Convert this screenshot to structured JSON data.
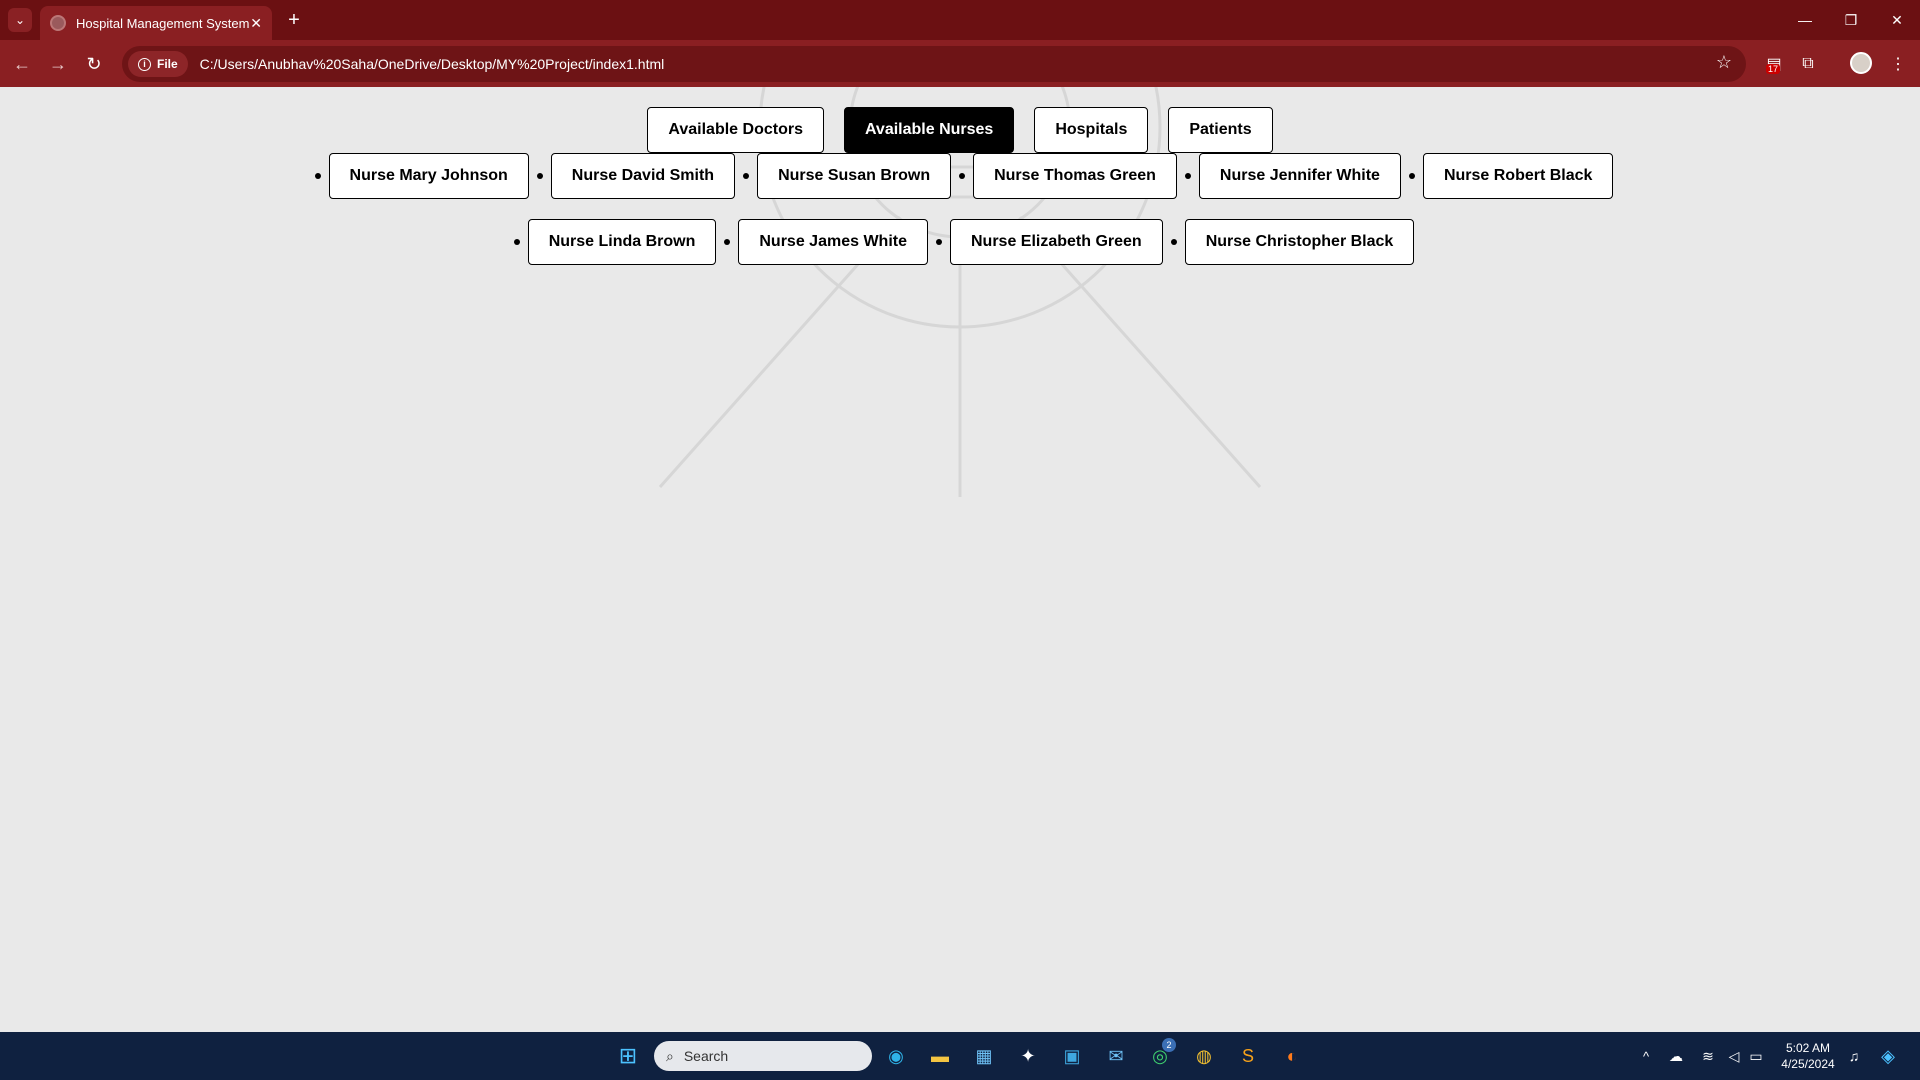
{
  "browser": {
    "tab_title": "Hospital Management System",
    "chip_label": "File",
    "url": "C:/Users/Anubhav%20Saha/OneDrive/Desktop/MY%20Project/index1.html",
    "ext_badge": "17"
  },
  "nav": {
    "items": [
      {
        "label": "Available Doctors",
        "active": false
      },
      {
        "label": "Available Nurses",
        "active": true
      },
      {
        "label": "Hospitals",
        "active": false
      },
      {
        "label": "Patients",
        "active": false
      }
    ]
  },
  "nurses": [
    "Nurse Mary Johnson",
    "Nurse David Smith",
    "Nurse Susan Brown",
    "Nurse Thomas Green",
    "Nurse Jennifer White",
    "Nurse Robert Black",
    "Nurse Linda Brown",
    "Nurse James White",
    "Nurse Elizabeth Green",
    "Nurse Christopher Black"
  ],
  "taskbar": {
    "search_placeholder": "Search",
    "whatsapp_badge": "2",
    "time": "5:02 AM",
    "date": "4/25/2024"
  },
  "colors": {
    "tabbar": "#6b1012",
    "toolbar": "#8a1f22",
    "page_bg": "#e9e9e9",
    "active_button": "#000000",
    "taskbar": "#0f2140"
  }
}
